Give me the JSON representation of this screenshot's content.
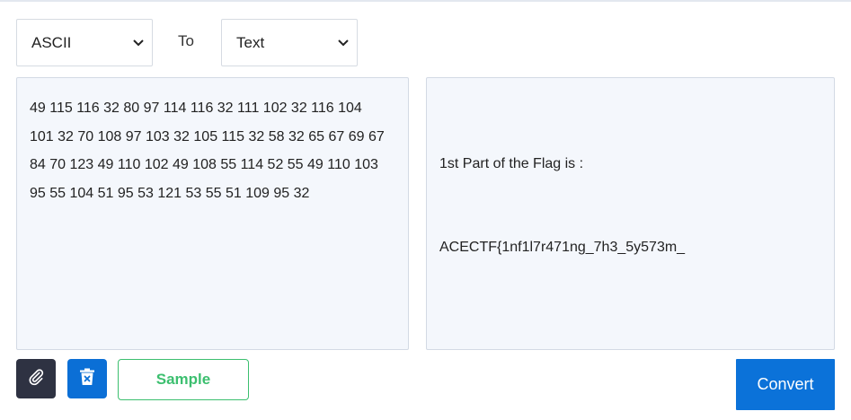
{
  "converter": {
    "from_select": {
      "selected": "ASCII",
      "icon": "chevron-down-icon"
    },
    "to_label": "To",
    "to_select": {
      "selected": "Text",
      "icon": "chevron-down-icon"
    },
    "input_text": "49 115 116 32 80 97 114 116 32 111 102 32 116 104 101 32 70 108 97 103 32 105 115 32 58 32 65 67 69 67 84 70 123 49 110 102 49 108 55 114 52 55 49 110 103 95 55 104 51 95 53 121 53 55 51 109 95 32",
    "output_lines": [
      "1st Part of the Flag is :",
      "ACECTF{1nf1l7r471ng_7h3_5y573m_"
    ]
  },
  "toolbar": {
    "attach_icon": "paperclip-icon",
    "clear_icon": "trash-icon",
    "sample_label": "Sample",
    "convert_label": "Convert"
  },
  "colors": {
    "attach_bg": "#2e3242",
    "clear_bg": "#0b6fd6",
    "sample_green": "#3cbf6f",
    "convert_bg": "#0b72d9",
    "pane_bg": "#f4f7fc"
  }
}
